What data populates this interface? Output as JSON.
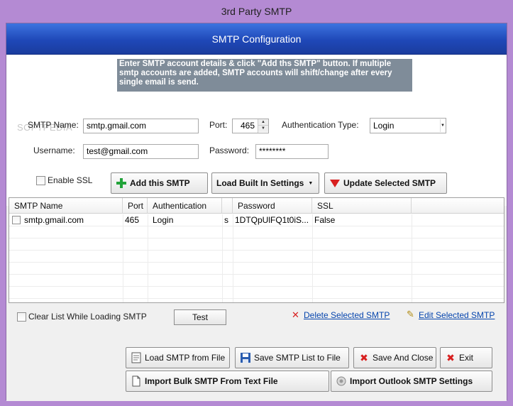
{
  "window": {
    "title": "3rd Party SMTP"
  },
  "header": {
    "title": "SMTP Configuration"
  },
  "notice": {
    "text": "Enter SMTP account details & click \"Add ths SMTP\" button. If multiple smtp accounts are added, SMTP accounts will shift/change after every single email is send."
  },
  "watermark": "SOFTPEDIA",
  "form": {
    "smtp_name_label": "SMTP Name:",
    "smtp_name_value": "smtp.gmail.com",
    "port_label": "Port:",
    "port_value": "465",
    "auth_label": "Authentication Type:",
    "auth_value": "Login",
    "username_label": "Username:",
    "username_value": "test@gmail.com",
    "password_label": "Password:",
    "password_value": "********",
    "enable_ssl_label": "Enable SSL"
  },
  "actions": {
    "add_smtp": "Add this SMTP",
    "load_builtin": "Load Built In Settings",
    "update_selected": "Update Selected SMTP"
  },
  "table": {
    "columns": [
      "SMTP Name",
      "Port",
      "Authentication",
      "",
      "Password",
      "SSL"
    ],
    "rows": [
      {
        "smtp_name": "smtp.gmail.com",
        "port": "465",
        "authentication": "Login",
        "extra": "s",
        "password": "1DTQpUlFQ1t0iS...",
        "ssl": "False"
      }
    ]
  },
  "list_options": {
    "clear_list_label": "Clear List While Loading SMTP",
    "test_button": "Test",
    "delete_selected": "Delete Selected SMTP",
    "edit_selected": "Edit Selected SMTP"
  },
  "bottom": {
    "load_file": "Load SMTP from File",
    "save_list": "Save SMTP List to File",
    "save_close": "Save And Close",
    "exit": "Exit",
    "import_bulk": "Import Bulk SMTP From Text File",
    "import_outlook": "Import Outlook SMTP Settings"
  },
  "colors": {
    "title_bar": "#b48ad3",
    "header_blue": "#1f48b8",
    "notice_bg": "#7f8c99",
    "link": "#0645ad",
    "add_green": "#22a33a",
    "update_red": "#d81f1f"
  }
}
